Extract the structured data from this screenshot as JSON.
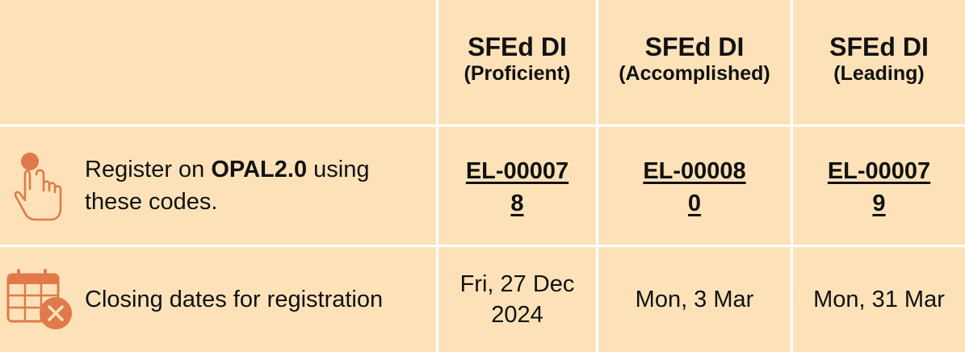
{
  "header": {
    "columns": [
      {
        "title": "SFEd DI",
        "level": "(Proficient)"
      },
      {
        "title": "SFEd DI",
        "level": "(Accomplished)"
      },
      {
        "title": "SFEd DI",
        "level": "(Leading)"
      }
    ]
  },
  "rows": {
    "register": {
      "icon": "tap-finger-icon",
      "label_prefix": "Register on ",
      "label_bold": "OPAL2.0",
      "label_suffix": " using these codes.",
      "codes": [
        "EL-000078",
        "EL-000080",
        "EL-000079"
      ]
    },
    "closing": {
      "icon": "calendar-cancel-icon",
      "label": "Closing dates for registration",
      "dates": [
        "Fri, 27 Dec 2024",
        "Mon, 3 Mar",
        "Mon, 31 Mar"
      ]
    }
  },
  "colors": {
    "cell_background": "#fde2b9",
    "icon": "#e07a4a",
    "grid_lines": "#ffffff"
  }
}
